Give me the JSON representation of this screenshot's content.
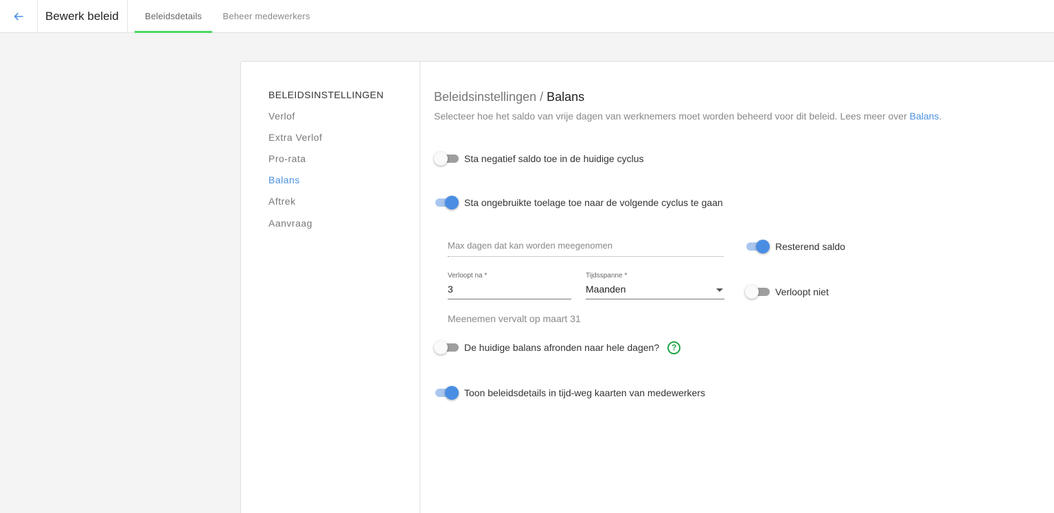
{
  "header": {
    "back_icon": "arrow-left-icon",
    "title": "Bewerk beleid",
    "tabs": [
      {
        "label": "Beleidsdetails",
        "active": true
      },
      {
        "label": "Beheer medewerkers",
        "active": false
      }
    ]
  },
  "sidebar": {
    "heading": "BELEIDSINSTELLINGEN",
    "items": [
      {
        "label": "Verlof",
        "active": false
      },
      {
        "label": "Extra Verlof",
        "active": false
      },
      {
        "label": "Pro-rata",
        "active": false
      },
      {
        "label": "Balans",
        "active": true
      },
      {
        "label": "Aftrek",
        "active": false
      },
      {
        "label": "Aanvraag",
        "active": false
      }
    ]
  },
  "main": {
    "breadcrumb_parent": "Beleidsinstellingen",
    "breadcrumb_sep": " / ",
    "breadcrumb_current": "Balans",
    "description": "Selecteer hoe het saldo van vrije dagen van werknemers moet worden beheerd voor dit beleid. Lees meer over ",
    "description_link": "Balans",
    "description_end": ".",
    "toggles": {
      "negative_balance": {
        "label": "Sta negatief saldo toe in de huidige cyclus",
        "on": false
      },
      "carry_over": {
        "label": "Sta ongebruikte toelage toe naar de volgende cyclus te gaan",
        "on": true
      },
      "remaining_balance": {
        "label": "Resterend saldo",
        "on": true
      },
      "never_expires": {
        "label": "Verloopt niet",
        "on": false
      },
      "round_balance": {
        "label": "De huidige balans afronden naar hele dagen?",
        "on": false
      },
      "show_details": {
        "label": "Toon beleidsdetails in tijd-weg kaarten van medewerkers",
        "on": true
      }
    },
    "max_days_placeholder": "Max dagen dat kan worden meegenomen",
    "expires_after": {
      "label": "Verloopt na *",
      "value": "3"
    },
    "timespan": {
      "label": "Tijdsspanne *",
      "value": "Maanden"
    },
    "carryover_note": "Meenemen vervalt op maart 31",
    "help_icon": "question-circle-icon",
    "colors": {
      "accent": "#4a90e2",
      "tab_underline": "#4cd964",
      "help": "#22a44a"
    }
  }
}
